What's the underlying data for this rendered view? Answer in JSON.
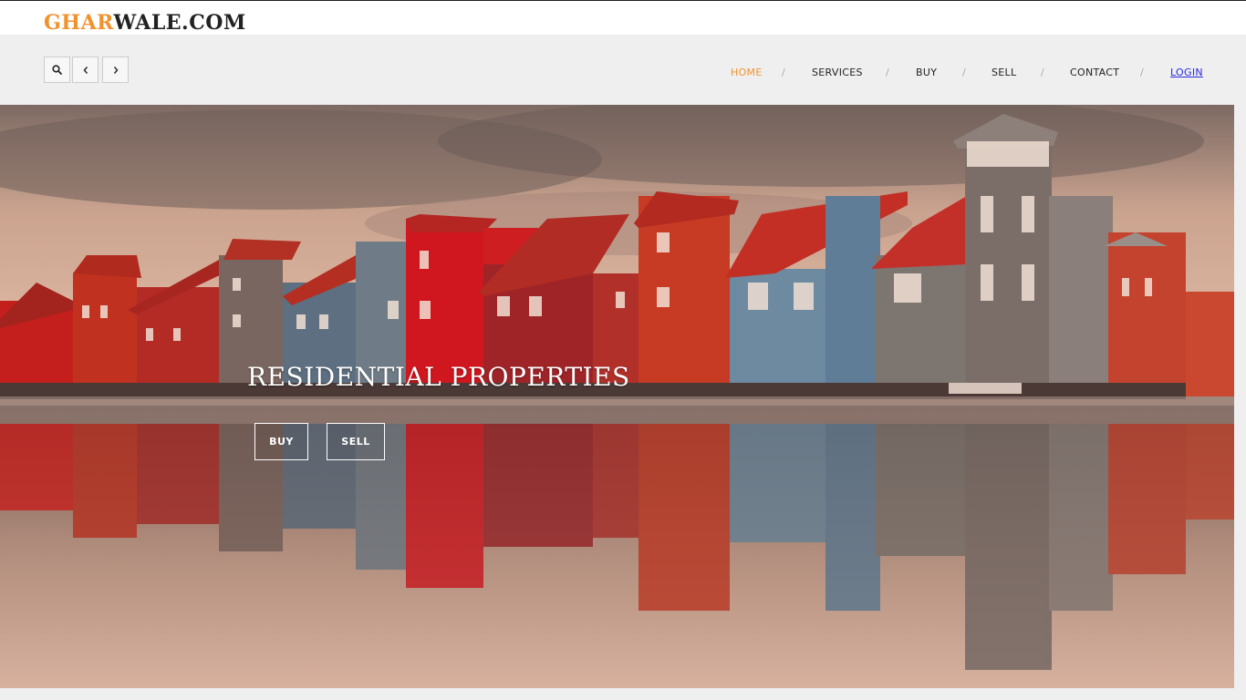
{
  "brand": {
    "logo_part1": "GHAR",
    "logo_part2": "WALE.COM"
  },
  "colors": {
    "accent": "#f0922e",
    "link": "#2a2ae0",
    "nav_text": "#222222"
  },
  "controls": {
    "search": "search-icon",
    "prev": "chevron-left-icon",
    "next": "chevron-right-icon"
  },
  "nav": {
    "items": [
      {
        "label": "HOME"
      },
      {
        "label": "SERVICES"
      },
      {
        "label": "BUY"
      },
      {
        "label": "SELL"
      },
      {
        "label": "CONTACT"
      },
      {
        "label": "LOGIN"
      }
    ],
    "separator": "/"
  },
  "hero": {
    "title": "RESIDENTIAL PROPERTIES",
    "buy_label": "BUY",
    "sell_label": "SELL",
    "image": "colorful waterfront houses reflected in water"
  }
}
